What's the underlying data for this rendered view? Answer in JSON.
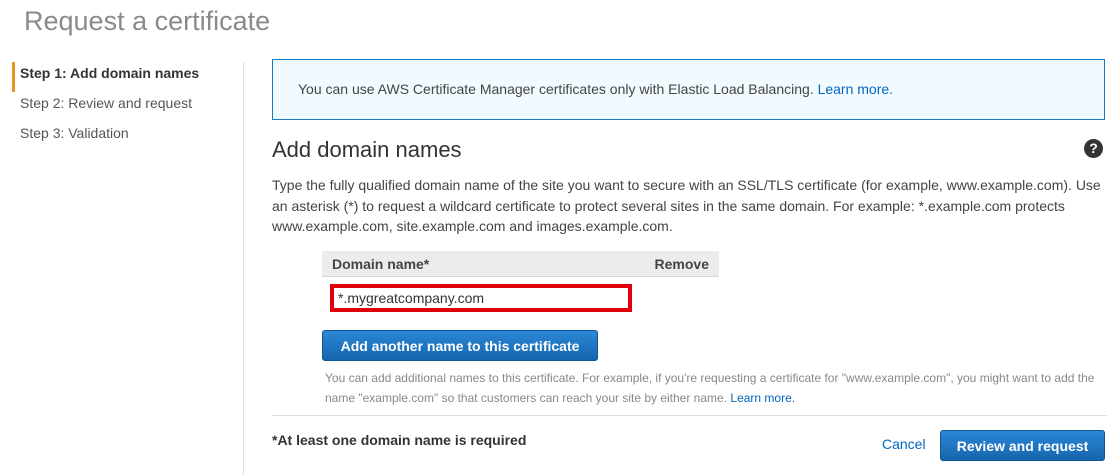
{
  "page": {
    "title": "Request a certificate"
  },
  "steps": [
    {
      "label": "Step 1: Add domain names",
      "active": true
    },
    {
      "label": "Step 2: Review and request",
      "active": false
    },
    {
      "label": "Step 3: Validation",
      "active": false
    }
  ],
  "info": {
    "text": "You can use AWS Certificate Manager certificates only with Elastic Load Balancing.",
    "link": "Learn more."
  },
  "section": {
    "title": "Add domain names",
    "description": "Type the fully qualified domain name of the site you want to secure with an SSL/TLS certificate (for example, www.example.com). Use an asterisk (*) to request a wildcard certificate to protect several sites in the same domain. For example: *.example.com protects www.example.com, site.example.com and images.example.com."
  },
  "table": {
    "col_domain": "Domain name*",
    "col_remove": "Remove",
    "domain_value": "*.mygreatcompany.com"
  },
  "add_button": "Add another name to this certificate",
  "hint": {
    "text": "You can add additional names to this certificate. For example, if you're requesting a certificate for \"www.example.com\", you might want to add the name \"example.com\" so that customers can reach your site by either name.",
    "link": "Learn more."
  },
  "footer": {
    "required_note": "*At least one domain name is required",
    "cancel": "Cancel",
    "review": "Review and request"
  },
  "icons": {
    "help": "help-icon"
  },
  "colors": {
    "accent": "#e89324",
    "link": "#0066c0",
    "primary_button": "#1a73c0",
    "highlight_border": "#e0000b",
    "info_border": "#1a7bc4"
  }
}
